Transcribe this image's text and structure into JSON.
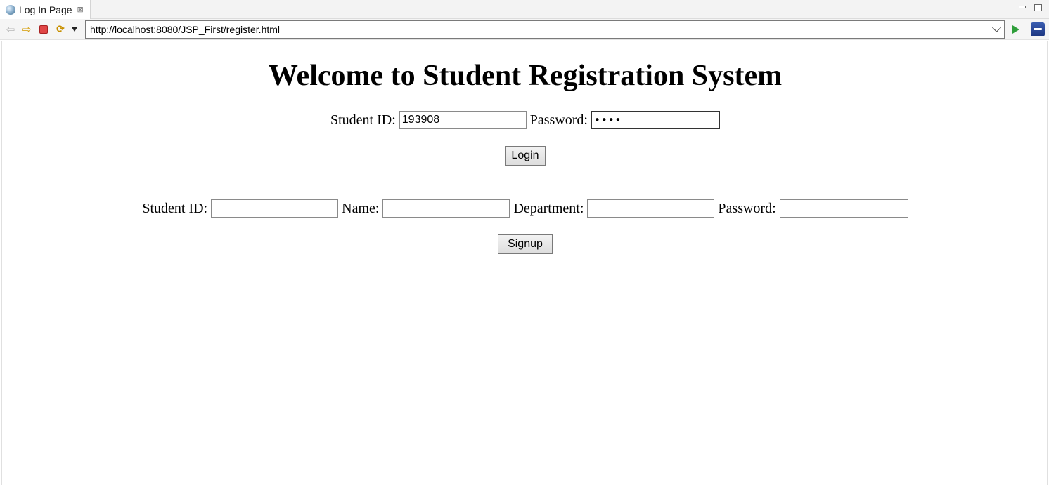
{
  "window": {
    "tab_title": "Log In Page",
    "tab_close": "⊠"
  },
  "toolbar": {
    "back_glyph": "⇦",
    "forward_glyph": "⇨",
    "refresh_glyph": "⟳",
    "url": "http://localhost:8080/JSP_First/register.html"
  },
  "page": {
    "title": "Welcome to Student Registration System",
    "login": {
      "student_id_label": "Student ID: ",
      "student_id_value": "193908",
      "password_label": " Password: ",
      "password_value": "••••",
      "button_label": "Login"
    },
    "signup": {
      "student_id_label": "Student ID: ",
      "name_label": " Name: ",
      "department_label": " Department: ",
      "password_label": " Password: ",
      "button_label": "Signup"
    }
  },
  "colors": {
    "stop": "#e04646",
    "go": "#2e9e3a",
    "forward": "#d49a00"
  }
}
